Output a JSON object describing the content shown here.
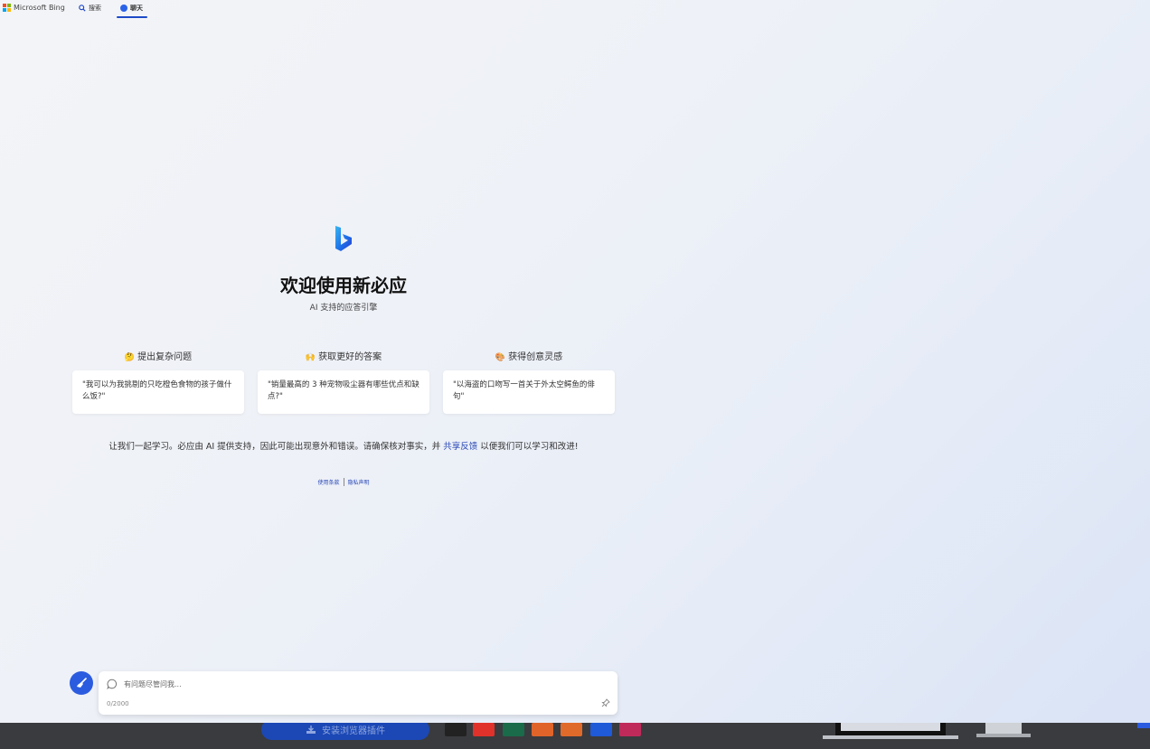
{
  "header": {
    "brand": "Microsoft Bing",
    "nav": [
      {
        "label": "搜索",
        "icon": "search-icon"
      },
      {
        "label": "聊天",
        "icon": "chat-icon",
        "active": true
      }
    ]
  },
  "hero": {
    "title": "欢迎使用新必应",
    "subtitle": "AI 支持的应答引擎"
  },
  "columns": [
    {
      "emoji": "🤔",
      "heading": "提出复杂问题",
      "example": "\"我可以为我挑剔的只吃橙色食物的孩子做什么饭?\""
    },
    {
      "emoji": "🙌",
      "heading": "获取更好的答案",
      "example": "\"销量最高的 3 种宠物吸尘器有哪些优点和缺点?\""
    },
    {
      "emoji": "🎨",
      "heading": "获得创意灵感",
      "example": "\"以海盗的口吻写一首关于外太空鳄鱼的俳句\""
    }
  ],
  "notice": {
    "before": "让我们一起学习。必应由 AI 提供支持，因此可能出现意外和错误。请确保核对事实，并",
    "link": "共享反馈",
    "after": "以便我们可以学习和改进!"
  },
  "footer_links": [
    "使用条款",
    "隐私声明"
  ],
  "composer": {
    "placeholder": "有问题尽管问我...",
    "counter": "0/2000"
  },
  "bottom_strip": {
    "button_label": "安装浏览器插件"
  },
  "colors": {
    "accent": "#2b5ce0",
    "link": "#2a48b8"
  }
}
